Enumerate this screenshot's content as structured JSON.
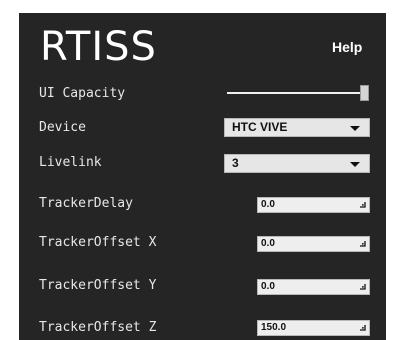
{
  "app": {
    "title": "RTISS",
    "help_label": "Help"
  },
  "settings": {
    "ui_capacity": {
      "label": "UI Capacity",
      "value": 1.0
    },
    "device": {
      "label": "Device",
      "value": "HTC VIVE"
    },
    "livelink": {
      "label": "Livelink",
      "value": "3"
    },
    "tracker_delay": {
      "label": "TrackerDelay",
      "value": "0.0"
    },
    "tracker_offset_x": {
      "label": "TrackerOffset X",
      "value": "0.0"
    },
    "tracker_offset_y": {
      "label": "TrackerOffset Y",
      "value": "0.0"
    },
    "tracker_offset_z": {
      "label": "TrackerOffset Z",
      "value": "150.0"
    }
  },
  "icons": {
    "dropdown": "chevron-down-icon",
    "field_resize": "resize-grip-icon"
  },
  "colors": {
    "panel_bg": "#252525",
    "text": "#ffffff",
    "control_bg": "#e6e6e6"
  }
}
